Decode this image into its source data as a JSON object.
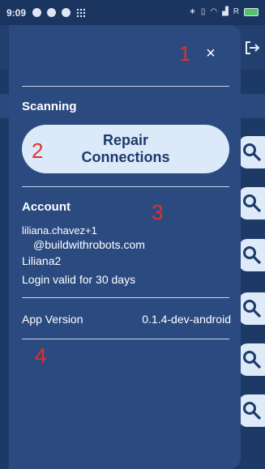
{
  "status_bar": {
    "time": "9:09",
    "right_icons": [
      "bluetooth-icon",
      "vibrate-icon",
      "wifi-icon",
      "signal-icon"
    ],
    "right_text": "R"
  },
  "background_app": {
    "logout_icon": "logout-icon",
    "search_icons": 6
  },
  "drawer": {
    "close_label": "×",
    "annotations": [
      "1",
      "2",
      "3",
      "4"
    ],
    "scanning": {
      "title": "Scanning",
      "repair_line1": "Repair",
      "repair_line2": "Connections"
    },
    "account": {
      "title": "Account",
      "email_line1": "liliana.chavez+1",
      "email_line2": "@buildwithrobots.com",
      "username": "Liliana2",
      "login_valid": "Login valid for 30 days"
    },
    "app_version": {
      "label": "App Version",
      "value": "0.1.4-dev-android"
    }
  },
  "colors": {
    "drawer_bg": "#2b4a80",
    "page_bg": "#1d3a67",
    "button_bg": "#dbe9f9",
    "button_text": "#1e3a6b",
    "annotation": "#e0312b"
  }
}
